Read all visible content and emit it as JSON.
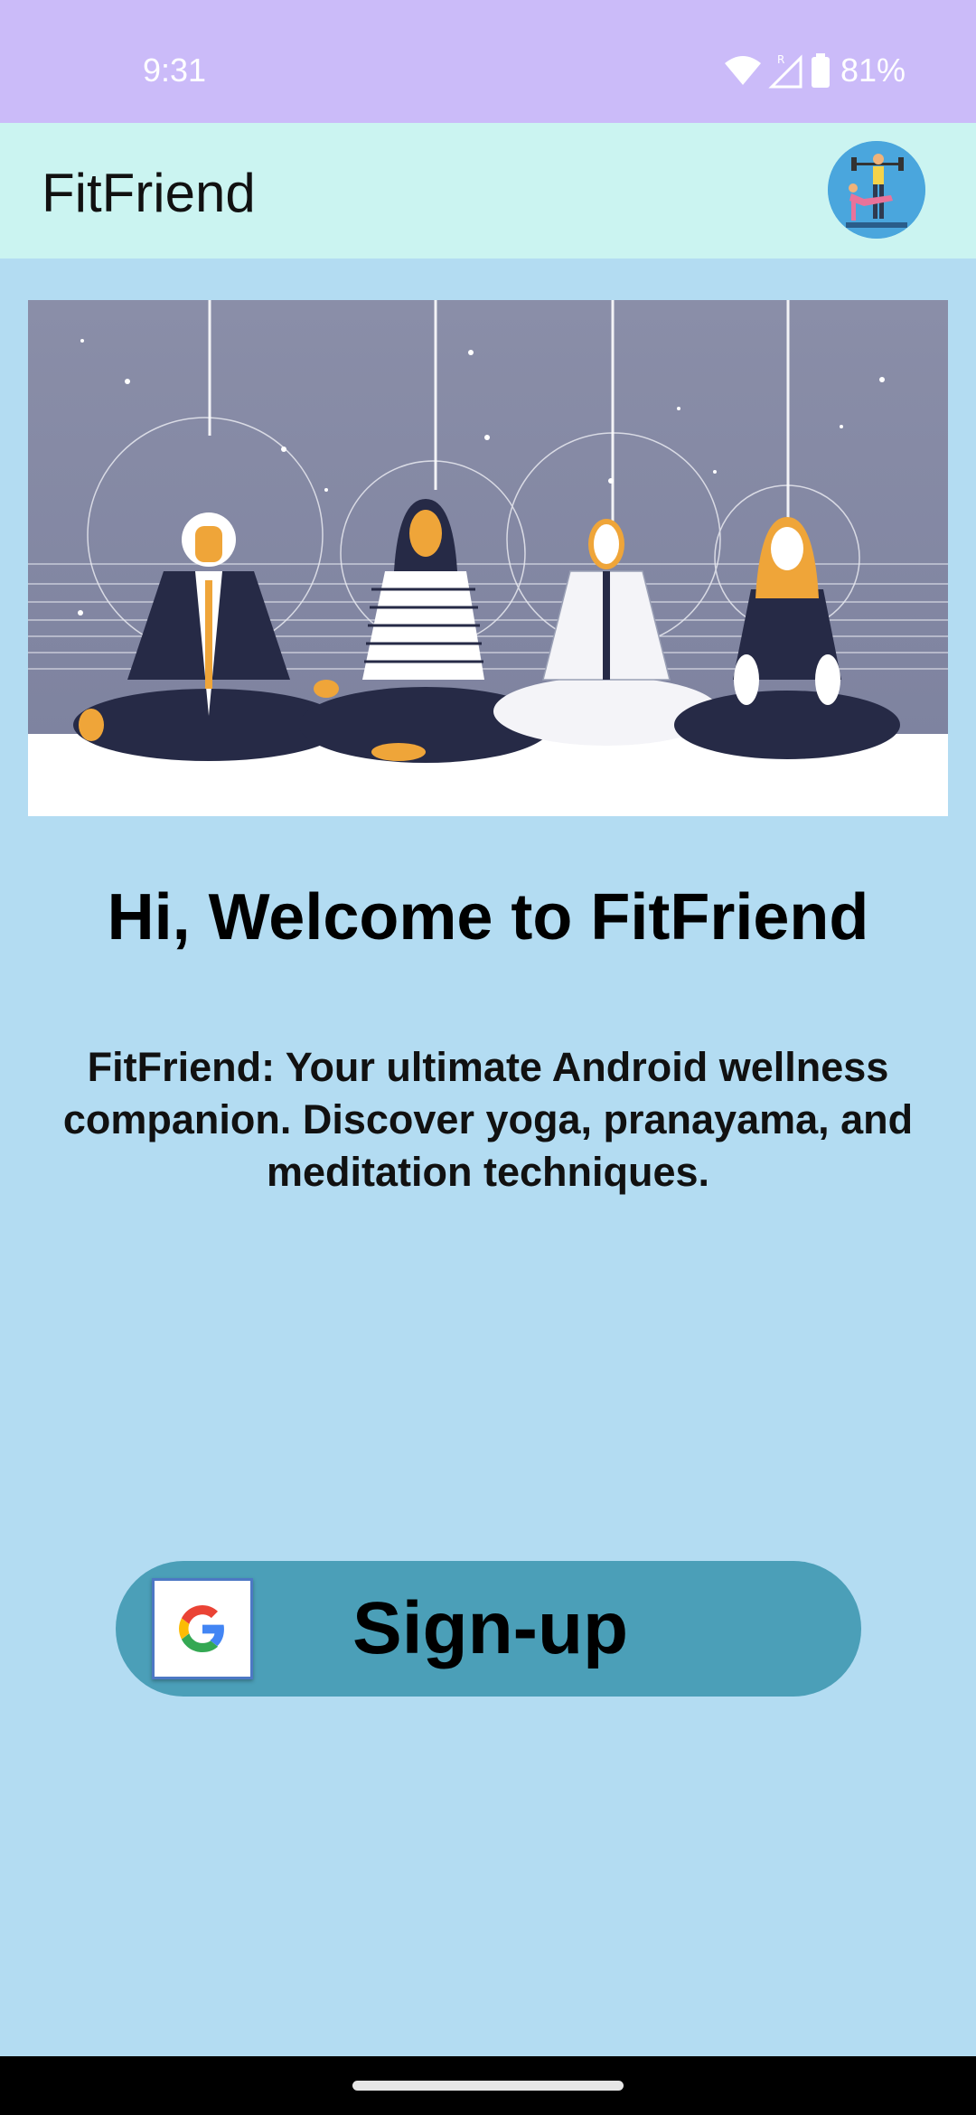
{
  "status_bar": {
    "time": "9:31",
    "battery": "81%",
    "icons": [
      "wifi-icon",
      "signal-icon",
      "battery-icon"
    ]
  },
  "app_bar": {
    "title": "FitFriend"
  },
  "main": {
    "welcome_title": "Hi, Welcome to FitFriend",
    "description": "FitFriend: Your ultimate Android wellness companion. Discover yoga, pranayama, and meditation techniques."
  },
  "signup": {
    "label": "Sign-up",
    "icon": "google-logo-icon"
  },
  "colors": {
    "status_bar": "#cbbbf9",
    "app_bar": "#cbf4f1",
    "background": "#b3dcf2",
    "button": "#4b9fb8"
  }
}
